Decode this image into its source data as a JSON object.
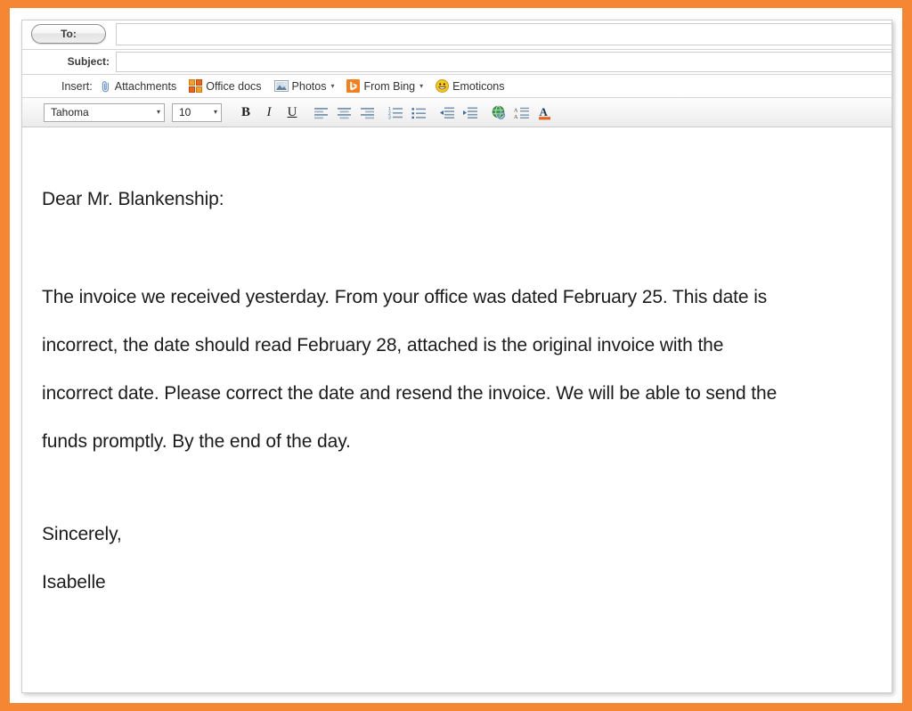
{
  "window": {
    "frame_color": "#f58634",
    "paper_color": "#ffffff"
  },
  "compose": {
    "to": {
      "button_label": "To:",
      "value": "",
      "placeholder": ""
    },
    "subject": {
      "label": "Subject:",
      "value": "",
      "placeholder": ""
    },
    "insert": {
      "label": "Insert:",
      "items": [
        {
          "label": "Attachments",
          "icon": "paperclip-icon",
          "has_caret": false
        },
        {
          "label": "Office docs",
          "icon": "office-docs-icon",
          "has_caret": false
        },
        {
          "label": "Photos",
          "icon": "photos-icon",
          "has_caret": true
        },
        {
          "label": "From Bing",
          "icon": "bing-icon",
          "has_caret": true
        },
        {
          "label": "Emoticons",
          "icon": "emoticons-icon",
          "has_caret": false
        }
      ],
      "caret_glyph": "▾"
    },
    "format_toolbar": {
      "font_family": "Tahoma",
      "font_size": "10",
      "caret_glyph": "▾",
      "buttons": [
        {
          "name": "bold-button",
          "label": "B"
        },
        {
          "name": "italic-button",
          "label": "I"
        },
        {
          "name": "underline-button",
          "label": "U"
        },
        {
          "name": "align-left-button",
          "label": ""
        },
        {
          "name": "align-center-button",
          "label": ""
        },
        {
          "name": "align-right-button",
          "label": ""
        },
        {
          "name": "numbered-list-button",
          "label": ""
        },
        {
          "name": "bulleted-list-button",
          "label": ""
        },
        {
          "name": "decrease-indent-button",
          "label": ""
        },
        {
          "name": "increase-indent-button",
          "label": ""
        },
        {
          "name": "insert-link-button",
          "label": ""
        },
        {
          "name": "line-spacing-button",
          "label": ""
        },
        {
          "name": "font-color-button",
          "label": "A"
        }
      ]
    }
  },
  "message": {
    "salutation": "Dear Mr. Blankenship:",
    "paragraph_lines": [
      "The invoice we received yesterday. From your office was dated February 25.  This date is",
      "incorrect, the date should read February 28, attached is the original invoice with the",
      "incorrect date. Please correct the date and resend the invoice. We will be able to send the",
      "funds promptly. By the end of the day."
    ],
    "closing": "Sincerely,",
    "signature": "Isabelle"
  }
}
